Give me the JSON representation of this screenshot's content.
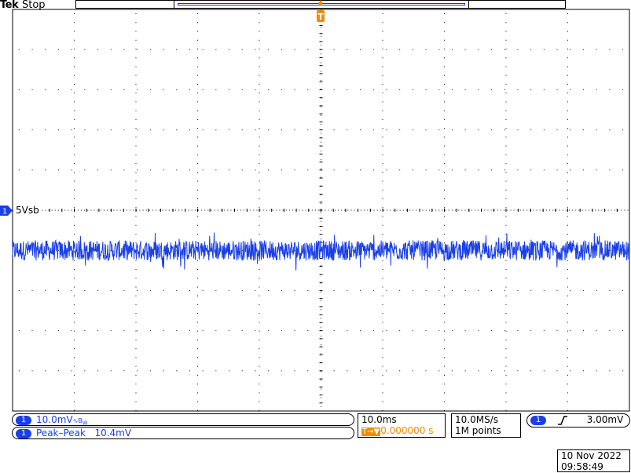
{
  "header": {
    "brand": "Tek",
    "acquisition_state": "Stop"
  },
  "trigger": {
    "position_marker": "T",
    "source_badge": "1",
    "level": "3.00mV",
    "slope_icon": "rising-edge-icon"
  },
  "channel": {
    "badge": "1",
    "label": "5Vsb",
    "scale": "10.0mV",
    "coupling_icon": "bandwidth-limit-icon",
    "color": "#1a3fe8"
  },
  "measurement": {
    "badge": "1",
    "name": "Peak–Peak",
    "value": "10.4mV"
  },
  "timebase": {
    "scale": "10.0ms",
    "trigger_delay_prefix": "T→▼",
    "trigger_delay": "0.000000 s"
  },
  "sampling": {
    "rate": "10.0MS/s",
    "record_length": "1M points"
  },
  "timestamp": {
    "date": "10 Nov 2022",
    "time": "09:58:49"
  },
  "colors": {
    "trace": "#1a3fe8",
    "trigger": "#f08c00",
    "grid": "#000000"
  },
  "chart_data": {
    "type": "line",
    "title": "",
    "xlabel": "",
    "ylabel": "",
    "divisions": {
      "x": 10,
      "y": 10
    },
    "x_per_div": "10.0ms",
    "y_per_div": "10.0mV",
    "xlim_ms": [
      -50,
      50
    ],
    "ylim_mV": [
      -40,
      60
    ],
    "grid": true,
    "series": [
      {
        "name": "5Vsb",
        "offset_mV": 0,
        "peak_to_peak_mV": 10.4,
        "noise_band_mV": [
          -2.5,
          2.5
        ]
      }
    ]
  }
}
